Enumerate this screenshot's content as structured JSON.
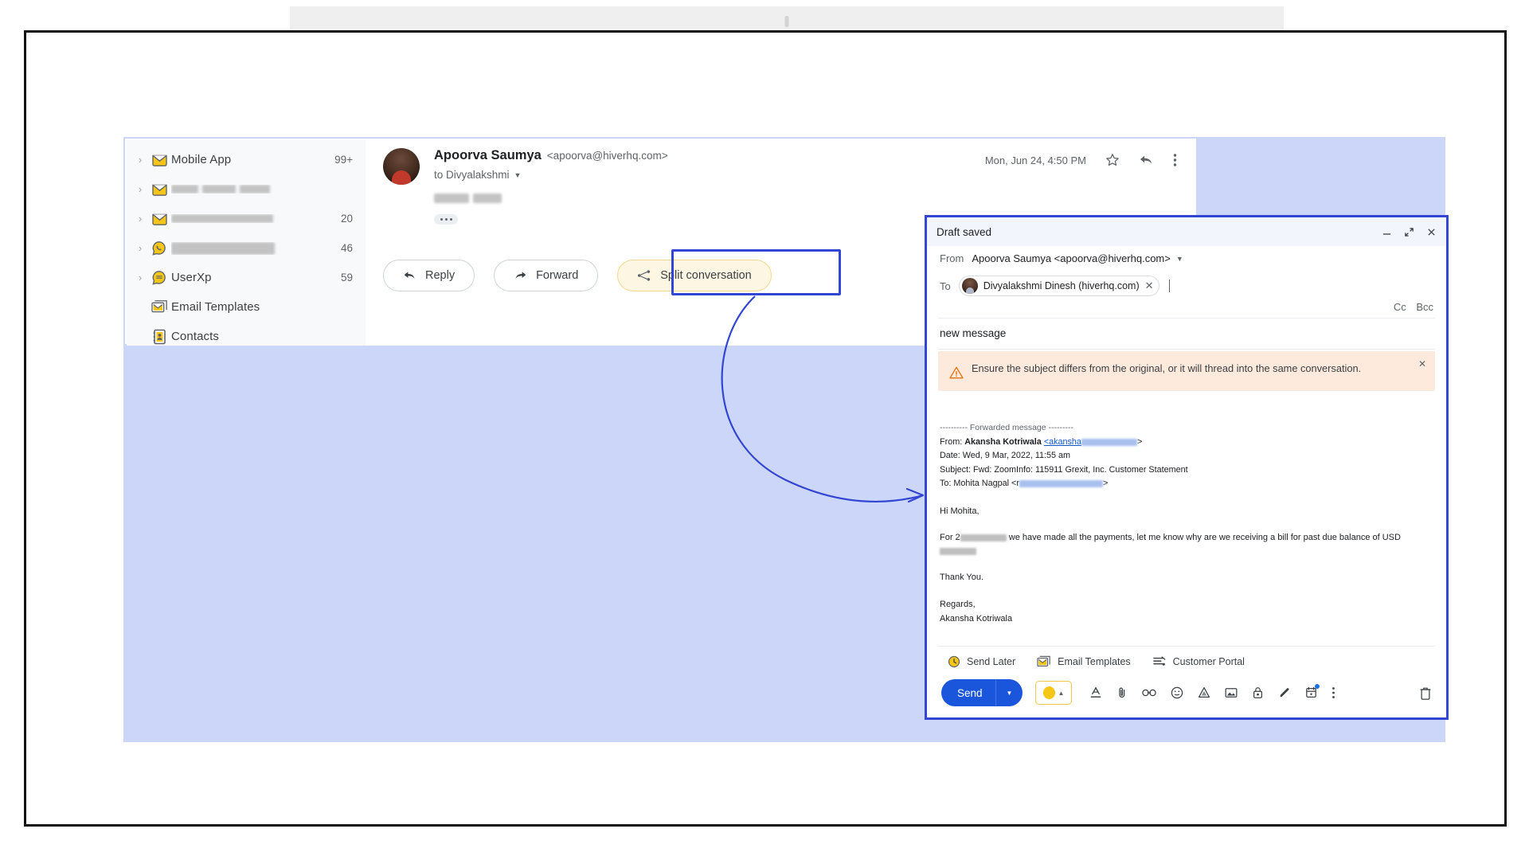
{
  "window": {
    "top_strip_present": true
  },
  "sidebar": {
    "items": [
      {
        "label": "Mobile App",
        "count": "99+",
        "icon": "shared-inbox-icon",
        "caret": true,
        "redacted": false
      },
      {
        "label": "",
        "count": "",
        "icon": "shared-inbox-icon",
        "caret": true,
        "redacted": true
      },
      {
        "label": "",
        "count": "20",
        "icon": "shared-inbox-icon",
        "caret": true,
        "redacted": true
      },
      {
        "label": "",
        "count": "46",
        "icon": "whatsapp-icon",
        "caret": true,
        "redacted": true
      },
      {
        "label": "UserXp",
        "count": "59",
        "icon": "chat-icon",
        "caret": true,
        "redacted": false
      },
      {
        "label": "Email Templates",
        "count": "",
        "icon": "templates-icon",
        "caret": false,
        "redacted": false
      },
      {
        "label": "Contacts",
        "count": "",
        "icon": "contacts-icon",
        "caret": false,
        "redacted": false
      }
    ]
  },
  "message": {
    "sender_name": "Apoorva Saumya",
    "sender_email": "<apoorva@hiverhq.com>",
    "to_line": "to Divyalakshmi",
    "date": "Mon, Jun 24, 4:50 PM",
    "subject_redacted": true,
    "actions": {
      "reply": "Reply",
      "forward": "Forward",
      "split": "Split conversation"
    },
    "highlight_color": "#3246d3"
  },
  "compose": {
    "title": "Draft saved",
    "window_buttons": {
      "minimize": "—",
      "expand": "⤢",
      "close": "✕"
    },
    "from_label": "From",
    "from_value": "Apoorva Saumya <apoorva@hiverhq.com>",
    "to_label": "To",
    "to_chip": "Divyalakshmi Dinesh (hiverhq.com)",
    "cc": "Cc",
    "bcc": "Bcc",
    "subject": "new message",
    "warning": "Ensure the subject differs from the original, or it will thread into the same conversation.",
    "forward_block": {
      "separator": "---------- Forwarded message ---------",
      "from_prefix": "From:",
      "from_name": "Akansha Kotriwala",
      "from_email_visible": "<akansha",
      "date": "Date: Wed, 9 Mar, 2022, 11:55 am",
      "subject": "Subject: Fwd: ZoomInfo: 115911 Grexit, Inc. Customer Statement",
      "to_prefix": "To: Mohita Nagpal <r"
    },
    "body": {
      "greeting": "Hi Mohita,",
      "paragraph_start": "For 2",
      "paragraph_mid": "we have made all the payments, let me know why are we receiving a bill for past due balance of USD",
      "thanks": "Thank You.",
      "regards": "Regards,",
      "signature": "Akansha Kotriwala"
    },
    "footer_apps": [
      {
        "label": "Send Later",
        "icon": "clock-icon"
      },
      {
        "label": "Email Templates",
        "icon": "templates-icon"
      },
      {
        "label": "Customer Portal",
        "icon": "portal-icon"
      }
    ],
    "send_label": "Send",
    "toolbar_icons": [
      "formatting-icon",
      "attach-icon",
      "link-icon",
      "emoji-icon",
      "drive-icon",
      "image-icon",
      "confidential-icon",
      "signature-icon",
      "schedule-icon",
      "more-options-icon"
    ],
    "trash_icon": "trash-icon",
    "accent_color": "#1a56db",
    "border_color": "#3246d3"
  },
  "colors": {
    "backdrop": "#ccd6f8",
    "sidebar_bg": "#f8f9fb",
    "warning_bg": "#fdeadd",
    "split_bg": "#fdf6e3",
    "hiver_yellow": "#f5c518"
  }
}
